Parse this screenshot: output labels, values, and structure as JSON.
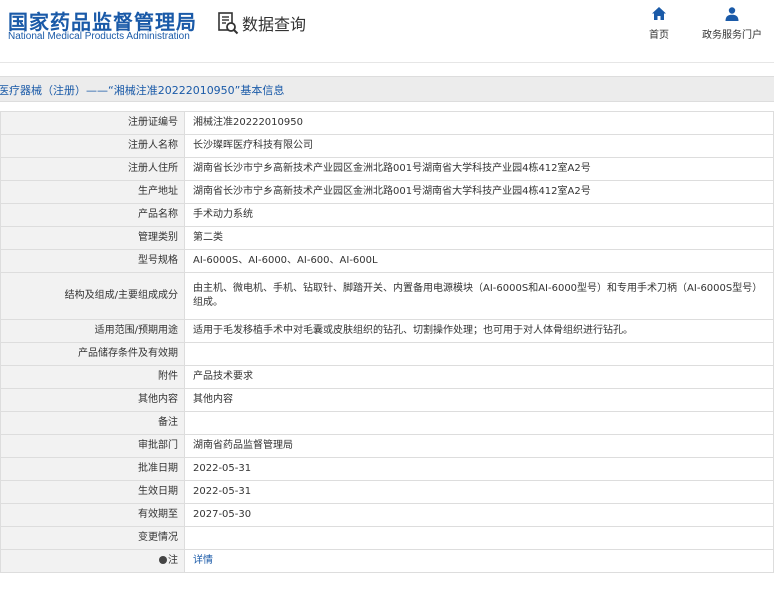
{
  "header": {
    "logo_cn": "国家药品监督管理局",
    "logo_en": "National Medical Products Administration",
    "query_label": "数据查询",
    "nav_home": "首页",
    "nav_portal": "政务服务门户"
  },
  "title": "医疗器械（注册）——“湘械注准20222010950”基本信息",
  "rows": [
    {
      "label": "注册证编号",
      "value": "湘械注准20222010950"
    },
    {
      "label": "注册人名称",
      "value": "长沙璨晖医疗科技有限公司"
    },
    {
      "label": "注册人住所",
      "value": "湖南省长沙市宁乡高新技术产业园区金洲北路001号湖南省大学科技产业园4栋412室A2号"
    },
    {
      "label": "生产地址",
      "value": "湖南省长沙市宁乡高新技术产业园区金洲北路001号湖南省大学科技产业园4栋412室A2号"
    },
    {
      "label": "产品名称",
      "value": "手术动力系统"
    },
    {
      "label": "管理类别",
      "value": "第二类"
    },
    {
      "label": "型号规格",
      "value": "AI-6000S、AI-6000、AI-600、AI-600L"
    },
    {
      "label": "结构及组成/主要组成成分",
      "value": "由主机、微电机、手机、钻取针、脚踏开关、内置备用电源模块（AI-6000S和AI-6000型号）和专用手术刀柄（AI-6000S型号）组成。"
    },
    {
      "label": "适用范围/预期用途",
      "value": "适用于毛发移植手术中对毛囊或皮肤组织的钻孔、切割操作处理；也可用于对人体骨组织进行钻孔。"
    },
    {
      "label": "产品储存条件及有效期",
      "value": ""
    },
    {
      "label": "附件",
      "value": "产品技术要求"
    },
    {
      "label": "其他内容",
      "value": "其他内容"
    },
    {
      "label": "备注",
      "value": ""
    },
    {
      "label": "审批部门",
      "value": "湖南省药品监督管理局"
    },
    {
      "label": "批准日期",
      "value": "2022-05-31"
    },
    {
      "label": "生效日期",
      "value": "2022-05-31"
    },
    {
      "label": "有效期至",
      "value": "2027-05-30"
    },
    {
      "label": "变更情况",
      "value": ""
    },
    {
      "label": "注",
      "value": "详情"
    }
  ],
  "colors": {
    "brand_blue": "#1a5aa8",
    "label_bg": "#f2f2f2",
    "border": "#dddddd"
  },
  "icons": [
    "query-search-icon",
    "home-icon",
    "user-icon",
    "note-icon"
  ]
}
